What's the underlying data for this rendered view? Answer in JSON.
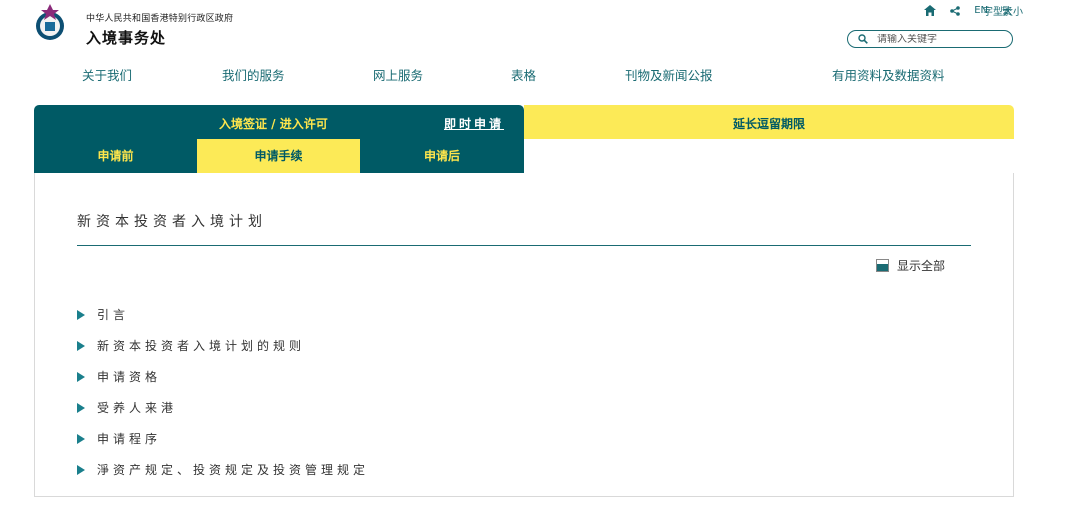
{
  "header": {
    "gov_name": "中华人民共和国香港特别行政区政府",
    "dept_name": "入境事务处",
    "lang_en": "EN",
    "lang_trad": "繁",
    "font_size": "字型大小",
    "search_placeholder": "请输入关键字"
  },
  "nav": {
    "items": [
      "关于我们",
      "我们的服务",
      "网上服务",
      "表格",
      "刊物及新闻公报",
      "有用资料及数据资料"
    ]
  },
  "tabs": {
    "entry_visa": "入境签证 / 进入许可",
    "apply_now": "即时申请",
    "extension": "延长逗留期限",
    "sub": [
      "申请前",
      "申请手续",
      "申请后"
    ]
  },
  "content": {
    "title": "新资本投资者入境计划",
    "show_all": "显示全部",
    "sections": [
      "引言",
      "新资本投资者入境计划的规则",
      "申请资格",
      "受养人来港",
      "申请程序",
      "淨资产规定、投资规定及投资管理规定"
    ]
  },
  "colors": {
    "teal": "#005a65",
    "yellow": "#fcea57",
    "accent_text": "#1a6b73"
  }
}
